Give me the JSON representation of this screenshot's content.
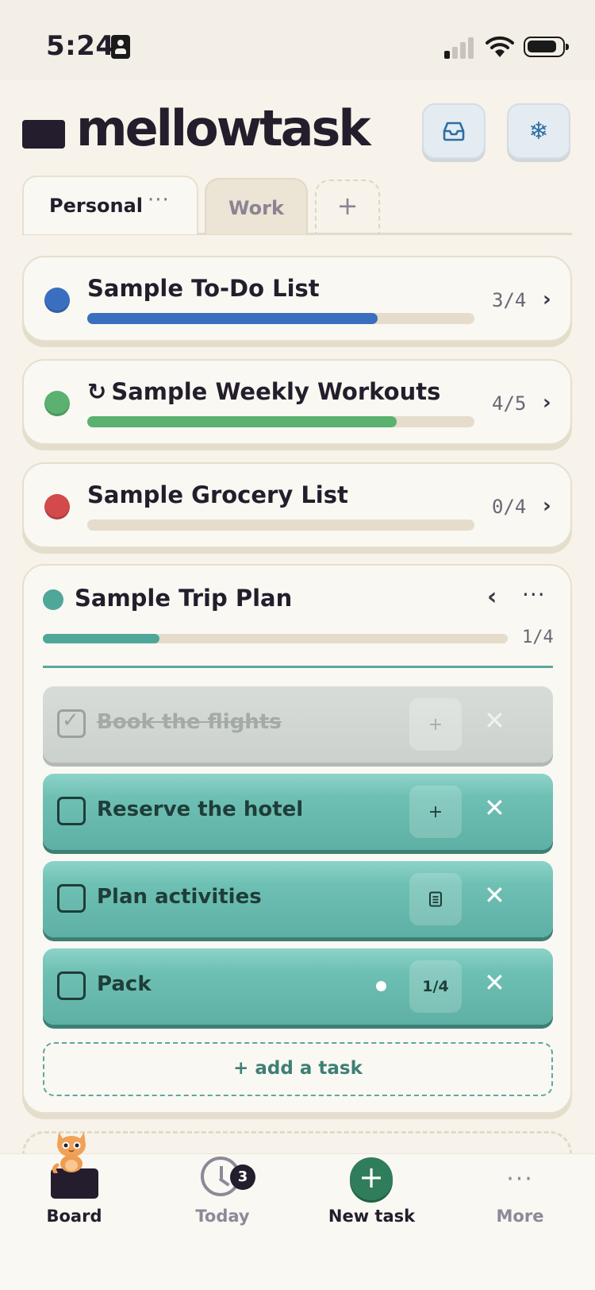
{
  "status": {
    "time": "5:24"
  },
  "header": {
    "title": "mellowtask",
    "inbox_icon": "inbox-tray-icon",
    "freeze_icon": "snowflake-icon",
    "freeze_glyph": "❄"
  },
  "tabs": {
    "items": [
      {
        "label": "Personal",
        "menu": "···"
      },
      {
        "label": "Work"
      }
    ],
    "add_label": "+"
  },
  "lists": [
    {
      "title": "Sample To-Do List",
      "count": "3/4",
      "progress": 0.75,
      "color": "#3a6fc0",
      "repeat": false,
      "chevron": "›"
    },
    {
      "title": "Sample Weekly Workouts",
      "count": "4/5",
      "progress": 0.8,
      "color": "#5ab170",
      "repeat": true,
      "repeat_glyph": "↻",
      "chevron": "›"
    },
    {
      "title": "Sample Grocery List",
      "count": "0/4",
      "progress": 0.0,
      "color": "#d24a4a",
      "repeat": false,
      "chevron": "›"
    }
  ],
  "trip": {
    "title": "Sample Trip Plan",
    "count": "1/4",
    "progress": 0.25,
    "color": "#4fa79a",
    "collapse_glyph": "‹",
    "menu_glyph": "···",
    "tasks": [
      {
        "label": "Book the flights",
        "done": true,
        "action": "+",
        "close": "✕"
      },
      {
        "label": "Reserve the hotel",
        "done": false,
        "action": "+",
        "close": "✕"
      },
      {
        "label": "Plan activities",
        "done": false,
        "action_icon": "note-icon",
        "close": "✕"
      },
      {
        "label": "Pack",
        "done": false,
        "action": "1/4",
        "has_note_dot": true,
        "close": "✕"
      }
    ],
    "add_task": "+ add a task"
  },
  "nav": {
    "board": "Board",
    "today": "Today",
    "today_badge": "3",
    "new_task": "New task",
    "new_glyph": "+",
    "more": "More",
    "more_glyph": "···",
    "active_color": "#241d2c",
    "inactive_color": "#8e8898"
  }
}
